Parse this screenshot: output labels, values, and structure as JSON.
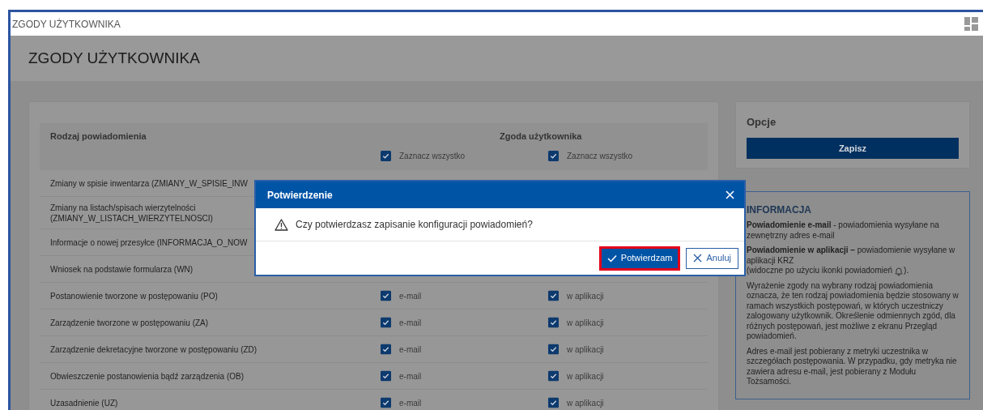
{
  "window": {
    "title": "ZGODY UŻYTKOWNIKA"
  },
  "page_title": "ZGODY UŻYTKOWNIKA",
  "table": {
    "columns": [
      "Rodzaj powiadomienia",
      "Zgoda użytkownika"
    ],
    "select_all": [
      {
        "label": "Zaznacz wszystko",
        "checked": true
      },
      {
        "label": "Zaznacz wszystko",
        "checked": true
      }
    ],
    "rows": [
      {
        "label": "Zmiany w spisie inwentarza (ZMIANY_W_SPISIE_INW"
      },
      {
        "label": "Zmiany na listach/spisach wierzytelności (ZMIANY_W_LISTACH_WIERZYTELNOSCI)"
      },
      {
        "label": "Informacje o nowej przesyłce (INFORMACJA_O_NOW"
      },
      {
        "label": "Wniosek na podstawie formularza (WN)"
      },
      {
        "label": "Postanowienie tworzone w postępowaniu (PO)",
        "consents": [
          {
            "label": "e-mail",
            "checked": true
          },
          {
            "label": "w aplikacji",
            "checked": true
          }
        ]
      },
      {
        "label": "Zarządzenie tworzone w postępowaniu (ZA)",
        "consents": [
          {
            "label": "e-mail",
            "checked": true
          },
          {
            "label": "w aplikacji",
            "checked": true
          }
        ]
      },
      {
        "label": "Zarządzenie dekretacyjne tworzone w postępowaniu (ZD)",
        "consents": [
          {
            "label": "e-mail",
            "checked": true
          },
          {
            "label": "w aplikacji",
            "checked": true
          }
        ]
      },
      {
        "label": "Obwieszczenie postanowienia bądź zarządzenia (OB)",
        "consents": [
          {
            "label": "e-mail",
            "checked": true
          },
          {
            "label": "w aplikacji",
            "checked": true
          }
        ]
      },
      {
        "label": "Uzasadnienie (UZ)",
        "consents": [
          {
            "label": "e-mail",
            "checked": true
          },
          {
            "label": "w aplikacji",
            "checked": true
          }
        ]
      }
    ]
  },
  "options": {
    "title": "Opcje",
    "save_button": "Zapisz"
  },
  "info": {
    "title": "INFORMACJA",
    "email_note": "**Powiadomienie e-mail** - powiadomienia wysyłane na zewnętrzny adres e-mail",
    "app_note": "**Powiadomienie w aplikacji –** powiadomienie wysyłane w aplikacji KRZ",
    "app_note_before_icon": "(widoczne po użyciu ikonki powiadomień",
    "app_note_after_icon": ").",
    "paragraphs": [
      "Wyrażenie zgody na wybrany rodzaj powiadomienia oznacza, że ten rodzaj powiadomienia będzie stosowany w ramach wszystkich postępowań, w których uczestniczy zalogowany użytkownik. Określenie odmiennych zgód, dla różnych postępowań, jest możliwe z ekranu Przegląd powiadomień.",
      "Adres e-mail jest pobierany z metryki uczestnika w szczegółach postępowania. W przypadku, gdy metryka nie zawiera adresu e-mail, jest pobierany z Modułu Tożsamości."
    ]
  },
  "dialog": {
    "title": "Potwierdzenie",
    "message": "Czy potwierdzasz zapisanie konfiguracji powiadomień?",
    "buttons": [
      {
        "kind": "primary",
        "label": "Potwierdzam",
        "focused": true
      },
      {
        "kind": "secondary",
        "label": "Anuluj",
        "focused": false
      }
    ]
  }
}
